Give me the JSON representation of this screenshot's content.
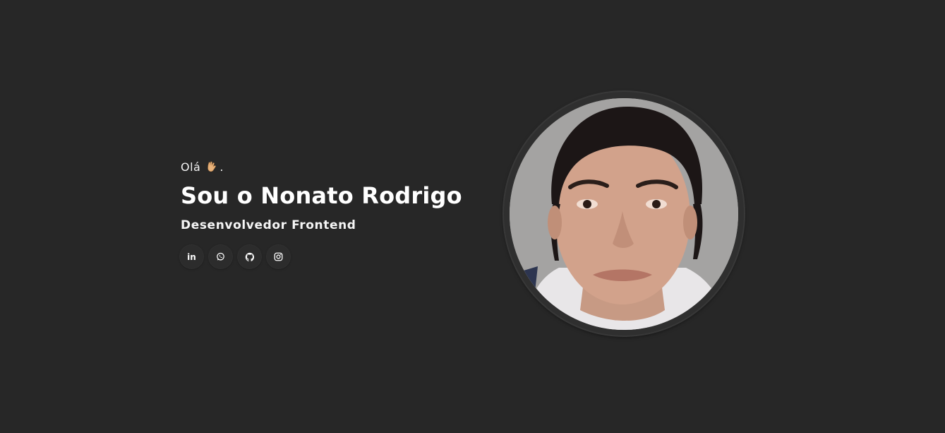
{
  "hero": {
    "greeting": "Olá",
    "greeting_emoji": "vulcan-salute-emoji",
    "greeting_punct": ".",
    "title": "Sou o Nonato Rodrigo",
    "subtitle": "Desenvolvedor Frontend"
  },
  "socials": [
    {
      "icon": "linkedin-icon",
      "label": "in"
    },
    {
      "icon": "whatsapp-icon"
    },
    {
      "icon": "github-icon"
    },
    {
      "icon": "instagram-icon"
    }
  ],
  "profile_photo": {
    "icon": "profile-photo"
  },
  "colors": {
    "background": "#272727",
    "text": "#ffffff",
    "button_bg": "#2c2c2c"
  }
}
